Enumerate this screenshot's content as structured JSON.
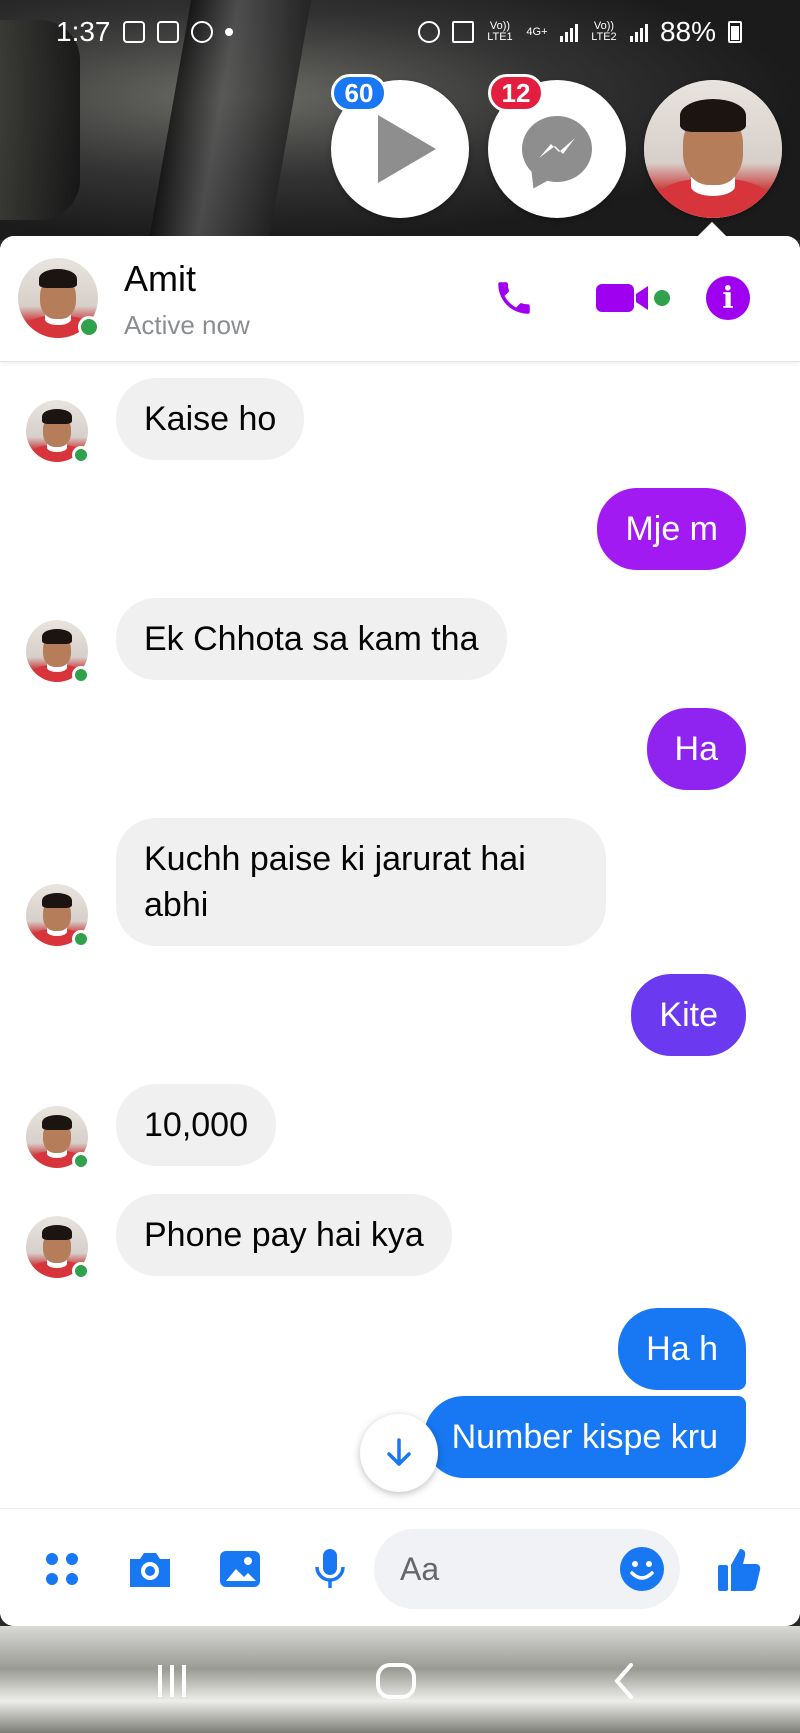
{
  "status_bar": {
    "time": "1:37",
    "battery": "88%",
    "net_labels": [
      "Vo)) LTE1",
      "4G+",
      "Vo)) LTE2"
    ]
  },
  "chat_heads": {
    "video_badge": "60",
    "messenger_badge": "12"
  },
  "header": {
    "name": "Amit",
    "status": "Active now"
  },
  "messages": [
    {
      "dir": "in",
      "text": "Kaise ho"
    },
    {
      "dir": "out",
      "text": "Mje m",
      "color": "#a21af2"
    },
    {
      "dir": "in",
      "text": "Ek Chhota sa kam tha"
    },
    {
      "dir": "out",
      "text": "Ha",
      "color": "#8f24f0"
    },
    {
      "dir": "in",
      "text": "Kuchh paise ki jarurat hai abhi"
    },
    {
      "dir": "out",
      "text": "Kite",
      "color": "#6b3af0"
    },
    {
      "dir": "in",
      "text": "10,000"
    },
    {
      "dir": "in",
      "text": "Phone pay hai kya"
    },
    {
      "dir": "out",
      "text": "Ha h",
      "color": "#1877f2"
    },
    {
      "dir": "out",
      "text": "Number kispe kru",
      "color": "#1877f2"
    }
  ],
  "composer": {
    "placeholder": "Aa"
  },
  "colors": {
    "accent_purple": "#a000f0",
    "messenger_blue": "#1877f2",
    "online_green": "#31a24c"
  },
  "icons": [
    "grid-icon",
    "camera-icon",
    "gallery-icon",
    "mic-icon",
    "emoji-icon",
    "thumbs-up-icon",
    "phone-icon",
    "video-icon",
    "info-icon",
    "arrow-down-icon"
  ]
}
